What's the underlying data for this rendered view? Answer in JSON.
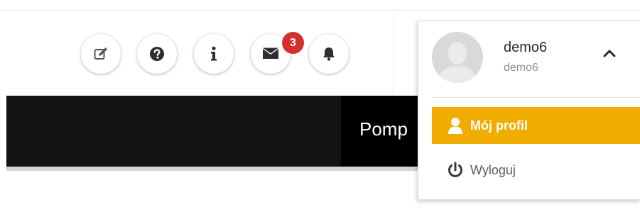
{
  "header": {
    "toolbar": [
      {
        "name": "edit-icon",
        "label": ""
      },
      {
        "name": "help-icon",
        "label": ""
      },
      {
        "name": "info-icon",
        "label": ""
      },
      {
        "name": "mail-icon",
        "label": ""
      },
      {
        "name": "bell-icon",
        "label": ""
      }
    ],
    "messages_badge": "3"
  },
  "banner": {
    "title": "Pomp"
  },
  "user_menu": {
    "username": "demo6",
    "login": "demo6",
    "toggle_icon": "chevron-up-icon",
    "items": [
      {
        "label": "Mój profil",
        "icon": "user-icon",
        "active": true
      },
      {
        "label": "Wyloguj",
        "icon": "power-icon",
        "active": false
      }
    ]
  },
  "colors": {
    "accent": "#f0ad00",
    "badge": "#d32f2f",
    "banner": "#121212"
  }
}
